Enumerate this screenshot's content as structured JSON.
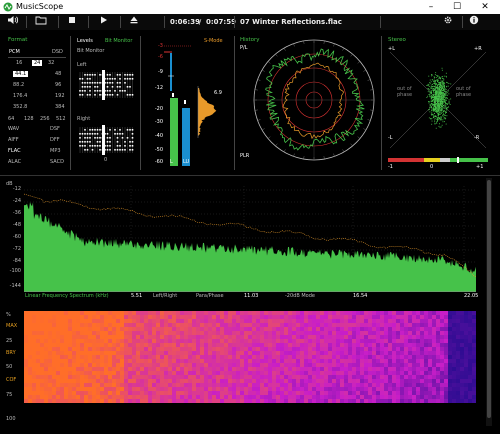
{
  "window": {
    "title": "MusicScope"
  },
  "toolbar": {
    "elapsed": "0:06:39",
    "separator": "/",
    "total": "0:07:59",
    "track": "07 Winter Reflections.flac"
  },
  "format": {
    "title": "Format",
    "header_left": "PCM",
    "header_right": "DSD",
    "bits": [
      "16",
      "24",
      "32"
    ],
    "selected_bits": "24",
    "rates": [
      {
        "pcm": "44.1",
        "dsd": "48"
      },
      {
        "pcm": "88.2",
        "dsd": "96"
      },
      {
        "pcm": "176.4",
        "dsd": "192"
      },
      {
        "pcm": "352.8",
        "dsd": "384"
      }
    ],
    "dsd_rates": [
      "64",
      "128",
      "256",
      "512"
    ],
    "selected_rate": "44.1",
    "codecs": [
      {
        "left": "WAV",
        "right": "DSF"
      },
      {
        "left": "AIFF",
        "right": "DFF"
      },
      {
        "left": "FLAC",
        "right": "MP3"
      },
      {
        "left": "ALAC",
        "right": "SACD"
      }
    ]
  },
  "levels": {
    "title": "Levels",
    "bit_monitor": "Bit Monitor",
    "left": "Left",
    "right": "Right",
    "scale": [
      "-3",
      "-6",
      "-9",
      "-12",
      "-20",
      "-30",
      "-40",
      "-50",
      "-60"
    ],
    "peak_value": "6.9",
    "s_mode": "S-Mode",
    "ticks_left": "0",
    "channels": [
      "L",
      "LU"
    ]
  },
  "history": {
    "title": "History",
    "top_label": "P/L",
    "bottom_label": "PLR"
  },
  "stereo": {
    "title": "Stereo",
    "plus_l": "+L",
    "plus_r": "+R",
    "minus_l": "-L",
    "minus_r": "-R",
    "out_of_phase_left": "out of\nphase",
    "out_of_phase_right": "out of\nphase",
    "corr_min": "-1",
    "corr_mid": "0",
    "corr_max": "+1"
  },
  "spectrum": {
    "db_label": "dB",
    "y_ticks": [
      "-12",
      "-24",
      "-36",
      "-48",
      "-60",
      "-72",
      "-84",
      "-100",
      "-144"
    ],
    "mode_label": "Linear Frequency Spectrum (kHz)",
    "x_ticks": [
      "5.51",
      "11.03",
      "16.54",
      "22.05"
    ],
    "options": [
      "Left/Right",
      "Para/Phase",
      "-20dB Mode"
    ]
  },
  "spectrogram": {
    "y_labels": [
      "%",
      "MAX",
      "25",
      "BRY",
      "50",
      "COF",
      "75",
      "100"
    ]
  },
  "colors": {
    "green": "#46c24a",
    "orange": "#e89a2a",
    "red": "#d33333",
    "blue": "#1a8fd0",
    "spectro_dark": "#2a0a8c",
    "spectro_mid": "#c020c8",
    "spectro_hot": "#ff6a1a"
  }
}
